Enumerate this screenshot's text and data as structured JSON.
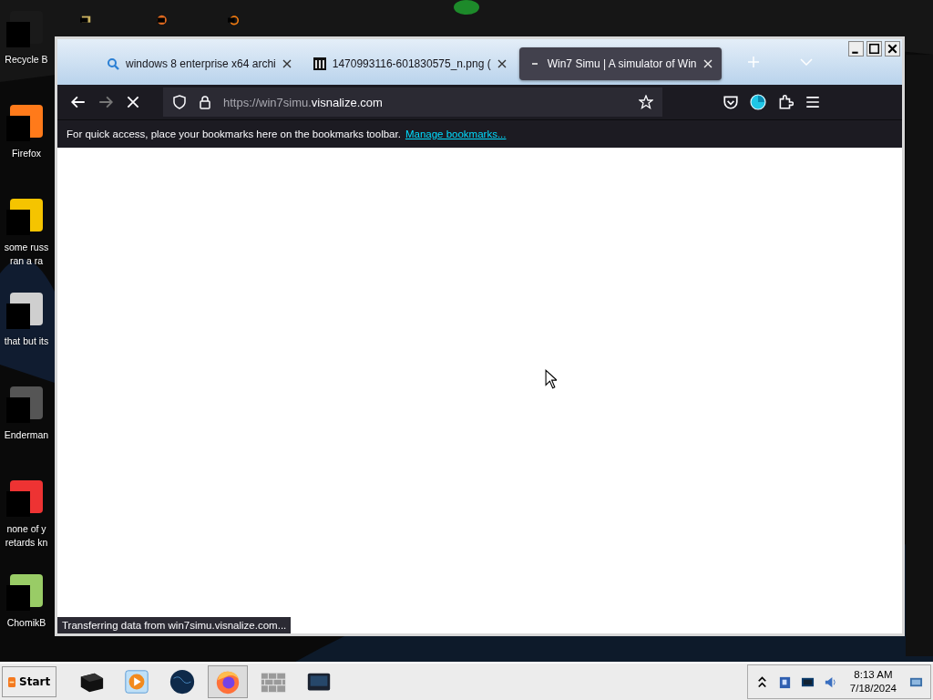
{
  "desktop": {
    "icons": [
      {
        "lines": [
          "Recycle B"
        ]
      },
      {
        "lines": [
          "Firefox"
        ]
      },
      {
        "lines": [
          "some russ",
          "ran a ra"
        ]
      },
      {
        "lines": [
          "that but its"
        ]
      },
      {
        "lines": [
          "Enderman"
        ]
      },
      {
        "lines": [
          "none of y",
          "retards kn"
        ]
      },
      {
        "lines": [
          "ChomikB"
        ]
      }
    ]
  },
  "browser": {
    "tabs": [
      {
        "kind": "search",
        "title": "windows 8 enterprise x64 archi",
        "selected": false
      },
      {
        "kind": "archive",
        "title": "1470993116-601830575_n.png (",
        "selected": false
      },
      {
        "kind": "page",
        "title": "Win7 Simu | A simulator of Win",
        "selected": true
      }
    ],
    "loading": true,
    "url": {
      "host_prefix": "https://win7simu.",
      "domain": "visnalize.com"
    },
    "bookmarks_bar": {
      "message": "For quick access, place your bookmarks here on the bookmarks toolbar.",
      "link": "Manage bookmarks..."
    },
    "status": "Transferring data from win7simu.visnalize.com..."
  },
  "taskbar": {
    "start": "Start",
    "apps": [
      {
        "kind": "terminal",
        "selected": false
      },
      {
        "kind": "media",
        "selected": false
      },
      {
        "kind": "globe",
        "selected": false
      },
      {
        "kind": "firefox",
        "selected": true
      },
      {
        "kind": "wall",
        "selected": false
      },
      {
        "kind": "monitor",
        "selected": false
      }
    ],
    "clock": {
      "time": "8:13 AM",
      "date": "7/18/2024"
    }
  }
}
